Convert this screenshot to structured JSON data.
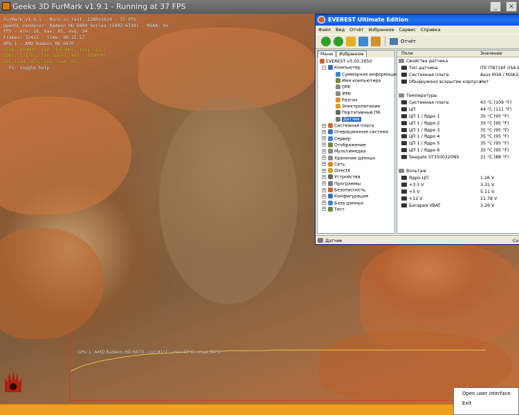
{
  "furmark": {
    "title": "Geeks 3D FurMark v1.9.1 - Running at 37 FPS",
    "osd": [
      "FurMark v1.9.1 - Burn-in test, 1280x1024 - 37 FPS",
      "OpenGL renderer: Radeon HD 6800 Series (1002-6738) - MSAA: 0x",
      "FPS - min: 16, max: 85, avg: 34",
      "Frames: 32411 - time: 00:15:57",
      "GPU 1 - AMD Radeon HD 6870",
      "  core: 900MHz, mem: 1050MHz, temp: 81°C",
      "  VDDC: 1.175V, fan speed: 48% (3009RPM)",
      "  GPU load: 97%, mem load: 0%",
      "",
      "- F1: toggle help"
    ],
    "graph_label": "GPU 1: AMD Radeon HD 6870 - cur:81°C - min:47°C - max:84°C",
    "graph_series": [
      47,
      55,
      60,
      64,
      67,
      70,
      72,
      74,
      75,
      76,
      77,
      78,
      78,
      79,
      79,
      80,
      80,
      80,
      80,
      81,
      81,
      81,
      81,
      81,
      81,
      81,
      81,
      81,
      81,
      81,
      81,
      81,
      81,
      81,
      81,
      81,
      81,
      81,
      81,
      81
    ]
  },
  "everest": {
    "title": "EVEREST Ultimate Edition",
    "menu": [
      "Файл",
      "Вид",
      "Отчёт",
      "Избранное",
      "Сервис",
      "Справка"
    ],
    "toolbar_report": "Отчёт",
    "tabs": [
      "Меню",
      "Избранное"
    ],
    "tree": [
      {
        "label": "EVEREST v5.00.1650",
        "level": 0,
        "exp": ""
      },
      {
        "label": "Компьютер",
        "level": 1,
        "exp": "-"
      },
      {
        "label": "Суммарная информация",
        "level": 2,
        "exp": ""
      },
      {
        "label": "Имя компьютера",
        "level": 2,
        "exp": ""
      },
      {
        "label": "DMI",
        "level": 2,
        "exp": ""
      },
      {
        "label": "IPMI",
        "level": 2,
        "exp": ""
      },
      {
        "label": "Разгон",
        "level": 2,
        "exp": ""
      },
      {
        "label": "Электропитание",
        "level": 2,
        "exp": ""
      },
      {
        "label": "Портативный ПК",
        "level": 2,
        "exp": ""
      },
      {
        "label": "Датчик",
        "level": 2,
        "exp": "",
        "selected": true
      },
      {
        "label": "Системная плата",
        "level": 1,
        "exp": "+"
      },
      {
        "label": "Операционная система",
        "level": 1,
        "exp": "+"
      },
      {
        "label": "Сервер",
        "level": 1,
        "exp": "+"
      },
      {
        "label": "Отображение",
        "level": 1,
        "exp": "+"
      },
      {
        "label": "Мультимедиа",
        "level": 1,
        "exp": "+"
      },
      {
        "label": "Хранение данных",
        "level": 1,
        "exp": "+"
      },
      {
        "label": "Сеть",
        "level": 1,
        "exp": "+"
      },
      {
        "label": "DirectX",
        "level": 1,
        "exp": "+"
      },
      {
        "label": "Устройства",
        "level": 1,
        "exp": "+"
      },
      {
        "label": "Программы",
        "level": 1,
        "exp": "+"
      },
      {
        "label": "Безопасность",
        "level": 1,
        "exp": "+"
      },
      {
        "label": "Конфигурация",
        "level": 1,
        "exp": "+"
      },
      {
        "label": "База данных",
        "level": 1,
        "exp": "+"
      },
      {
        "label": "Тест",
        "level": 1,
        "exp": "+"
      }
    ],
    "col_field": "Поле",
    "col_value": "Значение",
    "rows": [
      {
        "field": "Свойства датчика",
        "value": "",
        "group": true
      },
      {
        "field": "Тип датчика",
        "value": "ITE IT8716F (ISA E"
      },
      {
        "field": "Системная плата",
        "value": "Asus M3A / M3A32-M"
      },
      {
        "field": "Обнаружено вскрытие корпуса",
        "value": "Нет"
      },
      {
        "field": "",
        "value": ""
      },
      {
        "field": "Температуры",
        "value": "",
        "group": true
      },
      {
        "field": "Системная плата",
        "value": "43 °C  (109 °F)"
      },
      {
        "field": "ЦП",
        "value": "44 °C  (111 °F)"
      },
      {
        "field": "ЦП 1 / Ядро 1",
        "value": "35 °C  (95 °F)"
      },
      {
        "field": "ЦП 1 / Ядро 2",
        "value": "35 °C  (95 °F)"
      },
      {
        "field": "ЦП 1 / Ядро 3",
        "value": "35 °C  (95 °F)"
      },
      {
        "field": "ЦП 1 / Ядро 4",
        "value": "35 °C  (95 °F)"
      },
      {
        "field": "ЦП 1 / Ядро 5",
        "value": "35 °C  (95 °F)"
      },
      {
        "field": "ЦП 1 / Ядро 6",
        "value": "35 °C  (95 °F)"
      },
      {
        "field": "Seagate ST3500320NS",
        "value": "31 °C  (88 °F)"
      },
      {
        "field": "",
        "value": ""
      },
      {
        "field": "Вольтаж",
        "value": "",
        "group": true
      },
      {
        "field": "Ядро ЦП",
        "value": "1.26 V"
      },
      {
        "field": "+3.3 V",
        "value": "3.31 V"
      },
      {
        "field": "+5 V",
        "value": "5.11 V"
      },
      {
        "field": "+12 V",
        "value": "11.78 V"
      },
      {
        "field": "Батарея VBAT",
        "value": "3.26 V"
      }
    ],
    "status_left": "Датчик",
    "status_right": "Сор"
  },
  "popup": {
    "items": [
      "Open user interface",
      "Exit"
    ]
  },
  "colors": {
    "graph_line": "#e8c040",
    "taskbar": "#f0a020",
    "selection": "#316ac5"
  }
}
